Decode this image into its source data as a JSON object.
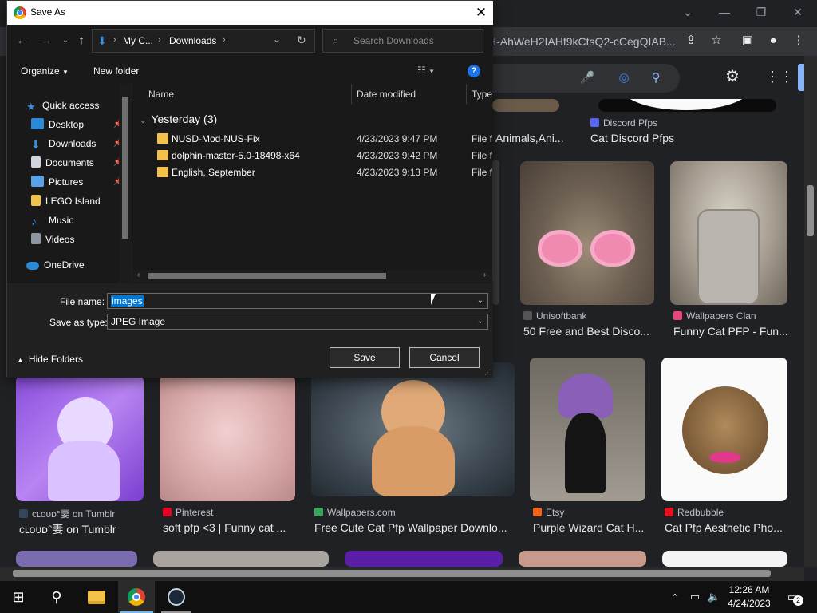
{
  "colors": {
    "accent": "#0078d4",
    "folder": "#f2c24a",
    "chrome_bg": "#202124"
  },
  "chrome": {
    "omnibox_text": "H-AhWeH2IAHf9kCtsQ2-cCegQIAB...",
    "results_row1": [
      {
        "source": "",
        "title": "Animals,Ani..."
      },
      {
        "source": "Discord Pfps",
        "title": "Cat Discord Pfps"
      }
    ],
    "results_row2": [
      {
        "source": "Unisoftbank",
        "title": "50 Free and Best Disco..."
      },
      {
        "source": "Wallpapers Clan",
        "title": "Funny Cat PFP - Fun..."
      }
    ],
    "results_row3": [
      {
        "source": "cʟᴏᴜᴅ°妻 on Tumblr",
        "title": "cʟᴏᴜᴅ°妻 on Tumblr"
      },
      {
        "source": "Pinterest",
        "title": "soft pfp <3 | Funny cat ..."
      },
      {
        "source": "Wallpapers.com",
        "title": "Free Cute Cat Pfp Wallpaper Downlo..."
      },
      {
        "source": "Etsy",
        "title": "Purple Wizard Cat H..."
      },
      {
        "source": "Redbubble",
        "title": "Cat Pfp Aesthetic Pho..."
      }
    ]
  },
  "dialog": {
    "title": "Save As",
    "breadcrumb": [
      "My C...",
      "Downloads"
    ],
    "search_placeholder": "Search Downloads",
    "organize_label": "Organize",
    "new_folder_label": "New folder",
    "nav_items": [
      {
        "label": "Quick access"
      },
      {
        "label": "Desktop"
      },
      {
        "label": "Downloads"
      },
      {
        "label": "Documents"
      },
      {
        "label": "Pictures"
      },
      {
        "label": "LEGO Island"
      },
      {
        "label": "Music"
      },
      {
        "label": "Videos"
      },
      {
        "label": "OneDrive"
      }
    ],
    "columns": {
      "name": "Name",
      "date": "Date modified",
      "type": "Type"
    },
    "group_label": "Yesterday (3)",
    "files": [
      {
        "name": "NUSD-Mod-NUS-Fix",
        "date": "4/23/2023 9:47 PM",
        "type": "File folder"
      },
      {
        "name": "dolphin-master-5.0-18498-x64",
        "date": "4/23/2023 9:42 PM",
        "type": "File folder"
      },
      {
        "name": "English, September",
        "date": "4/23/2023 9:13 PM",
        "type": "File folder"
      }
    ],
    "file_name_label": "File name:",
    "file_name_value": "images",
    "save_type_label": "Save as type:",
    "save_type_value": "JPEG Image",
    "hide_folders_label": "Hide Folders",
    "save_label": "Save",
    "cancel_label": "Cancel"
  },
  "taskbar": {
    "time": "12:26 AM",
    "date": "4/24/2023",
    "notifications": "2"
  }
}
